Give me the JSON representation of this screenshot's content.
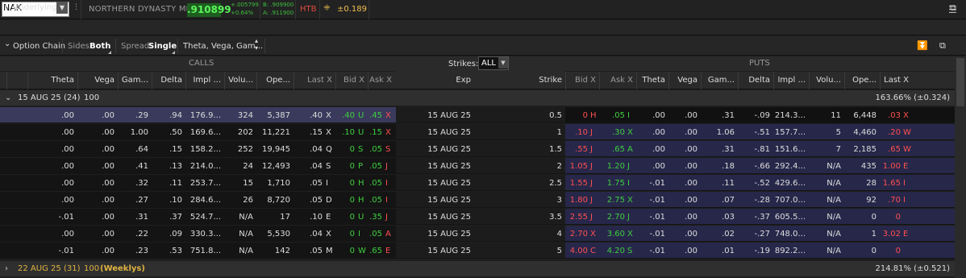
{
  "quote": {
    "symbol": "NAK",
    "company": "NORTHERN DYNASTY MIN",
    "last": ".910899",
    "change": "+.005799",
    "change_pct": "+0.64%",
    "bid": "B: .909900",
    "ask": "A: .911900",
    "htb": "HTB",
    "htb_value": "±0.189"
  },
  "underlying": {
    "label": "Underlying"
  },
  "option_chain_bar": {
    "title": "Option Chain",
    "sides_label": "Sides:",
    "sides_value": "Both",
    "spread_label": "Spread:",
    "spread_value": "Single",
    "layout_value": "Theta, Vega, Gam..."
  },
  "sections": {
    "calls": "CALLS",
    "puts": "PUTS",
    "strikes_label": "Strikes:",
    "strikes_value": "ALL"
  },
  "headers": {
    "calls": [
      "Theta",
      "Vega",
      "Gam...",
      "Delta",
      "Impl ...",
      "Volu...",
      "Ope...",
      "Last X",
      "Bid X",
      "Ask X"
    ],
    "exp": "Exp",
    "strike": "Strike",
    "puts": [
      "Bid X",
      "Ask X",
      "Theta",
      "Vega",
      "Gam...",
      "Delta",
      "Impl ...",
      "Volu...",
      "Ope...",
      "Last X"
    ]
  },
  "groups": [
    {
      "date": "15 AUG 25",
      "count": "(24)",
      "mult": "100",
      "extra": "",
      "iv": "163.66% (±0.324)"
    },
    {
      "date": "22 AUG 25",
      "count": "(31)",
      "mult": "100",
      "extra": "(Weeklys)",
      "iv": "214.81% (±0.521)"
    }
  ],
  "rows": [
    {
      "c": [
        ".00",
        ".00",
        ".29",
        ".94",
        "176.9...",
        "324",
        "5,387",
        ".40",
        "X",
        ".40",
        "U",
        ".45",
        "X"
      ],
      "exp": "15 AUG 25",
      "strike": "0.5",
      "p": [
        "0",
        "H",
        ".05",
        "I",
        ".00",
        ".00",
        ".31",
        "-.09",
        "214.3...",
        "11",
        "6,448",
        ".03",
        "X"
      ]
    },
    {
      "c": [
        ".00",
        ".00",
        "1.00",
        ".50",
        "169.6...",
        "202",
        "11,221",
        ".15",
        "X",
        ".10",
        "U",
        ".15",
        "X"
      ],
      "exp": "15 AUG 25",
      "strike": "1",
      "p": [
        ".10",
        "J",
        ".30",
        "X",
        ".00",
        ".00",
        "1.06",
        "-.51",
        "157.7...",
        "5",
        "4,460",
        ".20",
        "W"
      ]
    },
    {
      "c": [
        ".00",
        ".00",
        ".64",
        ".15",
        "158.2...",
        "252",
        "19,945",
        ".04",
        "Q",
        "0",
        "S",
        ".05",
        "S"
      ],
      "exp": "15 AUG 25",
      "strike": "1.5",
      "p": [
        ".55",
        "J",
        ".65",
        "A",
        ".00",
        ".00",
        ".31",
        "-.81",
        "151.6...",
        "7",
        "2,185",
        ".65",
        "W"
      ]
    },
    {
      "c": [
        ".00",
        ".00",
        ".41",
        ".13",
        "214.0...",
        "24",
        "12,493",
        ".04",
        "S",
        "0",
        "P",
        ".05",
        "J"
      ],
      "exp": "15 AUG 25",
      "strike": "2",
      "p": [
        "1.05",
        "J",
        "1.20",
        "J",
        ".00",
        ".00",
        ".18",
        "-.66",
        "292.4...",
        "N/A",
        "435",
        "1.00",
        "E"
      ]
    },
    {
      "c": [
        ".00",
        ".00",
        ".32",
        ".11",
        "253.7...",
        "15",
        "1,710",
        ".05",
        "I",
        "0",
        "H",
        ".05",
        "I"
      ],
      "exp": "15 AUG 25",
      "strike": "2.5",
      "p": [
        "1.55",
        "J",
        "1.75",
        "I",
        "-.01",
        ".00",
        ".11",
        "-.52",
        "429.6...",
        "N/A",
        "28",
        "1.65",
        "I"
      ]
    },
    {
      "c": [
        ".00",
        ".00",
        ".27",
        ".10",
        "284.6...",
        "26",
        "8,720",
        ".05",
        "D",
        "0",
        "H",
        ".05",
        "I"
      ],
      "exp": "15 AUG 25",
      "strike": "3",
      "p": [
        "1.80",
        "J",
        "2.75",
        "X",
        "-.01",
        ".00",
        ".07",
        "-.28",
        "707.0...",
        "N/A",
        "92",
        ".70",
        "I"
      ]
    },
    {
      "c": [
        "-.01",
        ".00",
        ".31",
        ".37",
        "524.7...",
        "N/A",
        "17",
        ".10",
        "E",
        "0",
        "U",
        ".35",
        "J"
      ],
      "exp": "15 AUG 25",
      "strike": "3.5",
      "p": [
        "2.55",
        "J",
        "2.70",
        "J",
        "-.01",
        ".00",
        ".03",
        "-.37",
        "605.5...",
        "N/A",
        "0",
        "0",
        ""
      ]
    },
    {
      "c": [
        ".00",
        ".00",
        ".22",
        ".09",
        "330.3...",
        "N/A",
        "5,530",
        ".04",
        "X",
        "0",
        "I",
        ".05",
        "A"
      ],
      "exp": "15 AUG 25",
      "strike": "4",
      "p": [
        "2.70",
        "X",
        "3.60",
        "X",
        "-.01",
        ".00",
        ".02",
        "-.27",
        "748.0...",
        "N/A",
        "1",
        "3.02",
        "E"
      ]
    },
    {
      "c": [
        "-.01",
        ".00",
        ".23",
        ".53",
        "751.8...",
        "N/A",
        "142",
        ".05",
        "M",
        "0",
        "W",
        ".65",
        "E"
      ],
      "exp": "15 AUG 25",
      "strike": "5",
      "p": [
        "4.00",
        "C",
        "4.20",
        "S",
        "-.01",
        ".00",
        ".01",
        "-.19",
        "892.2...",
        "N/A",
        "0",
        "0",
        ""
      ]
    }
  ],
  "colors": {
    "up": "#3fcf3f",
    "down": "#ff5050",
    "put_bg": "#27274a",
    "selected_row": "#3a3a5c"
  }
}
